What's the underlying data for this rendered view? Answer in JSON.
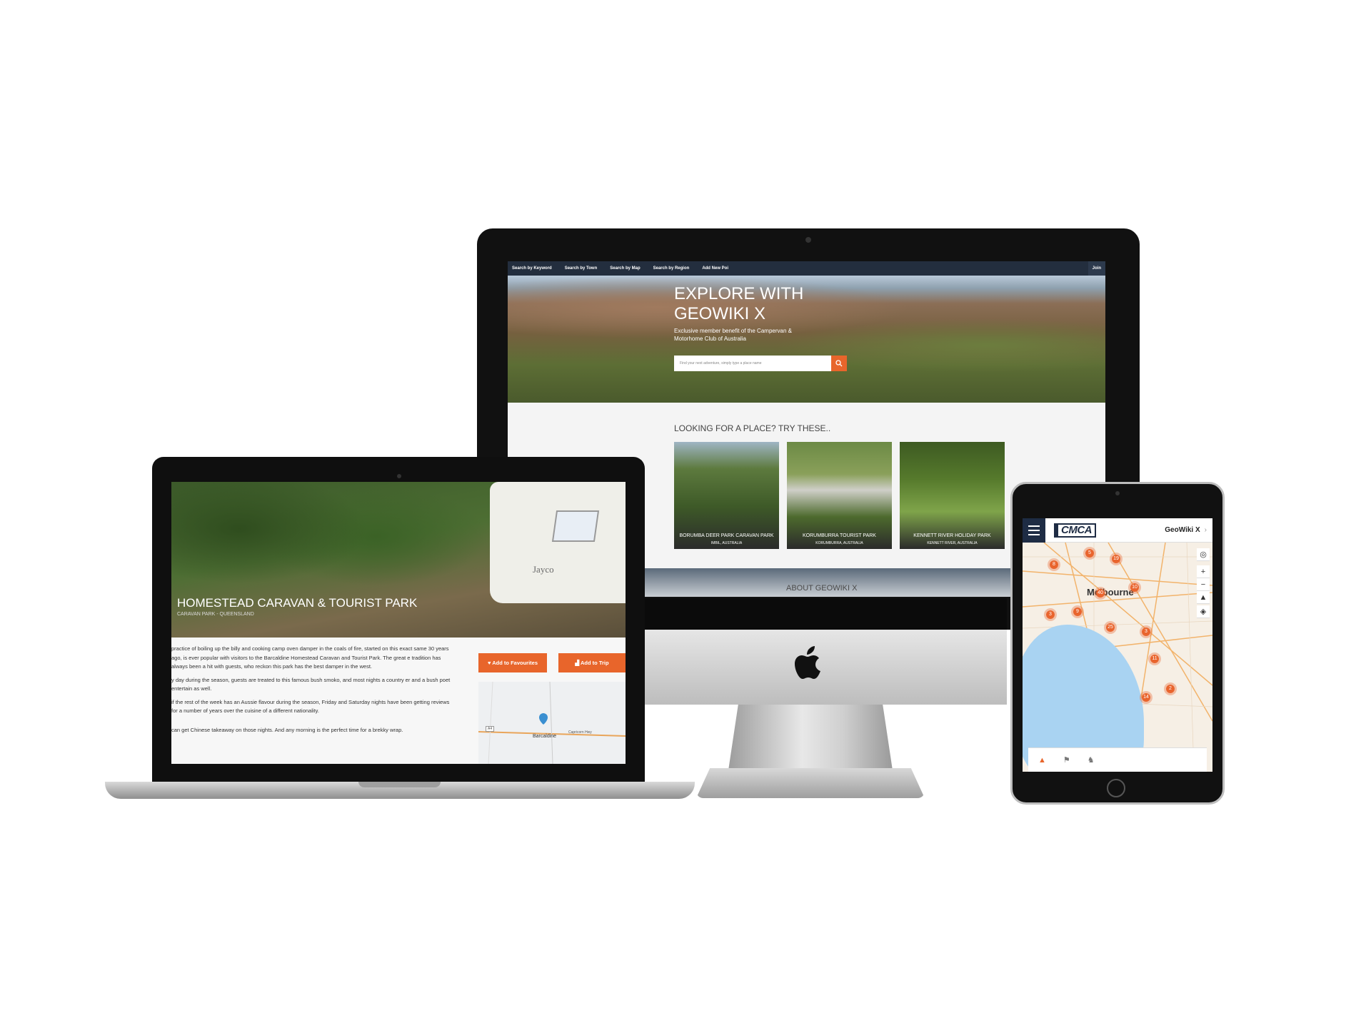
{
  "desktop": {
    "nav": [
      {
        "label": "Search by Keyword"
      },
      {
        "label": "Search by Town"
      },
      {
        "label": "Search by Map"
      },
      {
        "label": "Search by Region"
      },
      {
        "label": "Add New Poi"
      }
    ],
    "join_label": "Join",
    "hero": {
      "title": "EXPLORE WITH GEOWIKI X",
      "subtitle": "Exclusive member benefit of the Campervan & Motorhome Club of Australia",
      "search_placeholder": "Find your next adventure, simply type a place name"
    },
    "section_title": "LOOKING FOR A PLACE? TRY THESE..",
    "cards": [
      {
        "name": "BORUMBA DEER PARK CARAVAN PARK",
        "location": "IMBIL, AUSTRALIA"
      },
      {
        "name": "KORUMBURRA TOURIST PARK",
        "location": "KORUMBURRA, AUSTRALIA"
      },
      {
        "name": "KENNETT RIVER HOLIDAY PARK",
        "location": "KENNETT RIVER, AUSTRALIA"
      }
    ],
    "about_title": "ABOUT GEOWIKI X"
  },
  "laptop": {
    "title": "HOMESTEAD CARAVAN & TOURIST PARK",
    "subtitle": "CARAVAN PARK - QUEENSLAND",
    "paragraphs": [
      "practice of boiling up the billy and cooking camp oven damper in the coals of fire, started on this exact same 30 years ago, is ever popular with visitors to the Barcaldine Homestead Caravan and Tourist Park. The great e tradition has always been a hit with guests, who reckon this park has the best damper in the west.",
      "y day during the season, guests are treated to this famous bush smoko, and most nights a country er and a bush poet entertain as well.",
      "if the rest of the week has an Aussie flavour during the season, Friday and Saturday nights have been getting reviews for a number of years over the cuisine of a different nationality.",
      "can get Chinese takeaway on those nights. And any morning is the perfect time for a brekky wrap."
    ],
    "fav_label": "Add to Favourites",
    "trip_label": "Add to Trip",
    "map": {
      "town": "Barcaldine",
      "road": "Capricorn Hwy",
      "route": "A4"
    }
  },
  "tablet": {
    "brand": "CMCA",
    "title": "GeoWiki X",
    "city": "Melbourne",
    "clusters": [
      {
        "label": "5"
      },
      {
        "label": "19"
      },
      {
        "label": "8"
      },
      {
        "label": "10"
      },
      {
        "label": "40"
      },
      {
        "label": "3"
      },
      {
        "label": "9"
      },
      {
        "label": "25"
      },
      {
        "label": "3"
      },
      {
        "label": "11"
      },
      {
        "label": "14"
      },
      {
        "label": "2"
      }
    ]
  },
  "colors": {
    "accent": "#e8652b",
    "nav_dark": "#232e3e",
    "brand_navy": "#1e2c44"
  }
}
